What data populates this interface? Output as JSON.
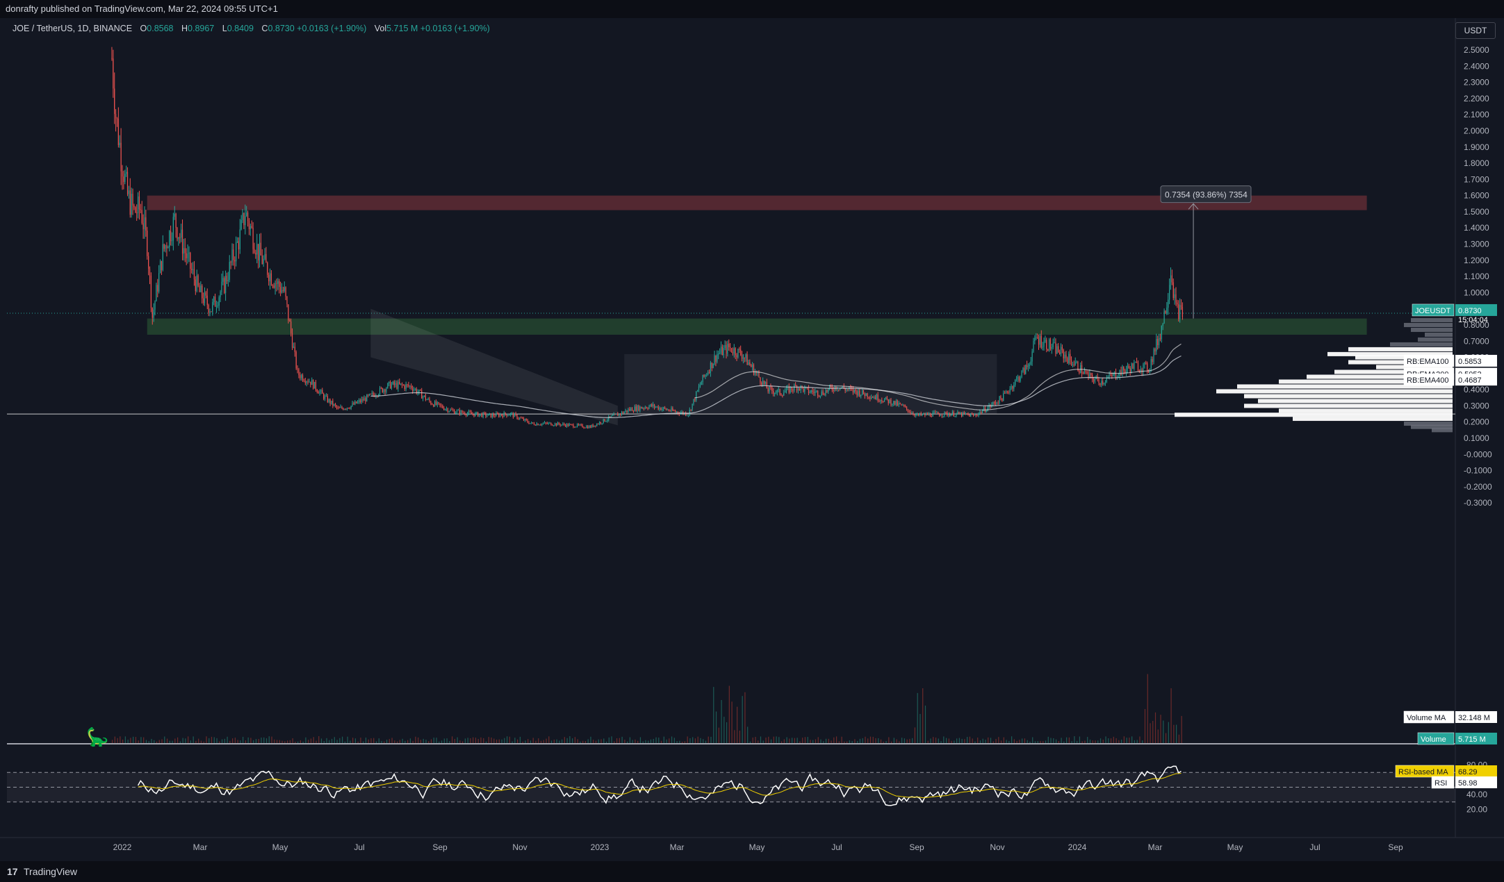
{
  "header": {
    "published_text": "donrafty published on TradingView.com, Mar 22, 2024 09:55 UTC+1"
  },
  "legend": {
    "symbol": "JOE / TetherUS, 1D, BINANCE",
    "o_label": "O",
    "o_value": "0.8568",
    "h_label": "H",
    "h_value": "0.8967",
    "l_label": "L",
    "l_value": "0.8409",
    "c_label": "C",
    "c_value": "0.8730",
    "change": "+0.0163 (+1.90%)",
    "vol_label": "Vol",
    "vol_value": "5.715 M",
    "vol_change": "+0.0163 (+1.90%)"
  },
  "currency_button": "USDT",
  "footer": {
    "logo": "17",
    "brand": "TradingView"
  },
  "colors": {
    "background": "#131722",
    "up": "#26a69a",
    "down": "#ef5350",
    "resistance_zone": "#5b2a33",
    "support_zone": "#23432f",
    "rsi": "#ffffff",
    "rsi_ma": "#f0d000"
  },
  "chart_data": [
    {
      "type": "line",
      "name": "price",
      "x_ticks": [
        "2022",
        "Mar",
        "May",
        "Jul",
        "Sep",
        "Nov",
        "2023",
        "Mar",
        "May",
        "Jul",
        "Sep",
        "Nov",
        "2024",
        "Mar",
        "May",
        "Jul",
        "Sep"
      ],
      "y_ticks": [
        "2.5000",
        "2.4000",
        "2.3000",
        "2.2000",
        "2.1000",
        "2.0000",
        "1.9000",
        "1.8000",
        "1.7000",
        "1.6000",
        "1.5000",
        "1.4000",
        "1.3000",
        "1.2000",
        "1.1000",
        "1.0000",
        "0.9000",
        "0.8000",
        "0.7000",
        "0.6000",
        "0.5000",
        "0.4000",
        "0.3000",
        "0.2000",
        "0.1000",
        "-0.0000",
        "-0.1000",
        "-0.2000",
        "-0.3000"
      ],
      "ylim": [
        -0.35,
        2.6
      ],
      "close_series": [
        [
          "2021-12-24",
          2.45
        ],
        [
          "2021-12-27",
          2.1
        ],
        [
          "2021-12-31",
          1.85
        ],
        [
          "2022-01-05",
          1.6
        ],
        [
          "2022-01-10",
          1.5
        ],
        [
          "2022-01-15",
          1.52
        ],
        [
          "2022-01-20",
          1.3
        ],
        [
          "2022-01-24",
          0.85
        ],
        [
          "2022-02-01",
          1.25
        ],
        [
          "2022-02-10",
          1.45
        ],
        [
          "2022-02-20",
          1.2
        ],
        [
          "2022-03-01",
          1.0
        ],
        [
          "2022-03-10",
          0.9
        ],
        [
          "2022-03-20",
          1.05
        ],
        [
          "2022-04-01",
          1.35
        ],
        [
          "2022-04-05",
          1.5
        ],
        [
          "2022-04-15",
          1.25
        ],
        [
          "2022-04-25",
          1.1
        ],
        [
          "2022-05-05",
          1.0
        ],
        [
          "2022-05-10",
          0.75
        ],
        [
          "2022-05-15",
          0.5
        ],
        [
          "2022-05-25",
          0.45
        ],
        [
          "2022-06-05",
          0.35
        ],
        [
          "2022-06-15",
          0.28
        ],
        [
          "2022-06-25",
          0.3
        ],
        [
          "2022-07-10",
          0.36
        ],
        [
          "2022-07-25",
          0.43
        ],
        [
          "2022-08-10",
          0.42
        ],
        [
          "2022-08-25",
          0.32
        ],
        [
          "2022-09-10",
          0.27
        ],
        [
          "2022-09-25",
          0.25
        ],
        [
          "2022-10-10",
          0.24
        ],
        [
          "2022-10-25",
          0.25
        ],
        [
          "2022-11-10",
          0.19
        ],
        [
          "2022-11-25",
          0.19
        ],
        [
          "2022-12-10",
          0.18
        ],
        [
          "2022-12-25",
          0.17
        ],
        [
          "2023-01-10",
          0.23
        ],
        [
          "2023-01-25",
          0.28
        ],
        [
          "2023-02-10",
          0.3
        ],
        [
          "2023-02-25",
          0.27
        ],
        [
          "2023-03-10",
          0.25
        ],
        [
          "2023-03-20",
          0.45
        ],
        [
          "2023-04-01",
          0.62
        ],
        [
          "2023-04-10",
          0.66
        ],
        [
          "2023-04-20",
          0.62
        ],
        [
          "2023-05-01",
          0.5
        ],
        [
          "2023-05-10",
          0.4
        ],
        [
          "2023-05-20",
          0.38
        ],
        [
          "2023-06-01",
          0.42
        ],
        [
          "2023-06-10",
          0.39
        ],
        [
          "2023-06-20",
          0.38
        ],
        [
          "2023-07-01",
          0.42
        ],
        [
          "2023-07-10",
          0.4
        ],
        [
          "2023-07-25",
          0.37
        ],
        [
          "2023-08-10",
          0.33
        ],
        [
          "2023-08-20",
          0.3
        ],
        [
          "2023-09-01",
          0.24
        ],
        [
          "2023-09-15",
          0.25
        ],
        [
          "2023-10-01",
          0.25
        ],
        [
          "2023-10-15",
          0.24
        ],
        [
          "2023-10-25",
          0.29
        ],
        [
          "2023-11-05",
          0.35
        ],
        [
          "2023-11-15",
          0.45
        ],
        [
          "2023-11-25",
          0.55
        ],
        [
          "2023-12-01",
          0.72
        ],
        [
          "2023-12-10",
          0.68
        ],
        [
          "2023-12-20",
          0.63
        ],
        [
          "2024-01-01",
          0.55
        ],
        [
          "2024-01-10",
          0.48
        ],
        [
          "2024-01-20",
          0.45
        ],
        [
          "2024-02-01",
          0.5
        ],
        [
          "2024-02-15",
          0.55
        ],
        [
          "2024-02-25",
          0.53
        ],
        [
          "2024-03-05",
          0.75
        ],
        [
          "2024-03-10",
          0.95
        ],
        [
          "2024-03-13",
          1.15
        ],
        [
          "2024-03-17",
          0.9
        ],
        [
          "2024-03-22",
          0.873
        ]
      ],
      "zones": [
        {
          "from_date": "2022-01-20",
          "to_date": "2024-08-10",
          "low": 1.51,
          "high": 1.6
        },
        {
          "from_date": "2022-01-20",
          "to_date": "2024-08-10",
          "low": 0.74,
          "high": 0.84
        }
      ],
      "horizontal_line": {
        "value": 0.25
      },
      "measure": {
        "from": 0.84,
        "to": 1.55,
        "label": "0.7354 (93.86%) 7354"
      },
      "price_labels": [
        {
          "name": "JOEUSDT",
          "value": "0.8730",
          "sub": "15:04:04",
          "level": 0.873
        },
        {
          "name": "RB:EMA100",
          "value": "0.5853",
          "level": 0.5853
        },
        {
          "name": "RB:EMA200",
          "value": "0.5052",
          "level": 0.5052
        },
        {
          "name": "RB:EMA400",
          "value": "0.4687",
          "level": 0.4687
        }
      ]
    },
    {
      "type": "bar",
      "name": "volume",
      "legend_labels": [
        {
          "name": "Volume MA",
          "value": "32.148 M"
        },
        {
          "name": "Volume",
          "value": "5.715 M"
        }
      ]
    },
    {
      "type": "line",
      "name": "rsi",
      "y_ticks": [
        "80.00",
        "40.00",
        "20.00"
      ],
      "ylim": [
        10,
        90
      ],
      "bands": [
        70,
        50,
        30
      ],
      "legend_labels": [
        {
          "name": "RSI-based MA",
          "value": "68.29"
        },
        {
          "name": "RSI",
          "value": "58.98"
        }
      ]
    }
  ]
}
